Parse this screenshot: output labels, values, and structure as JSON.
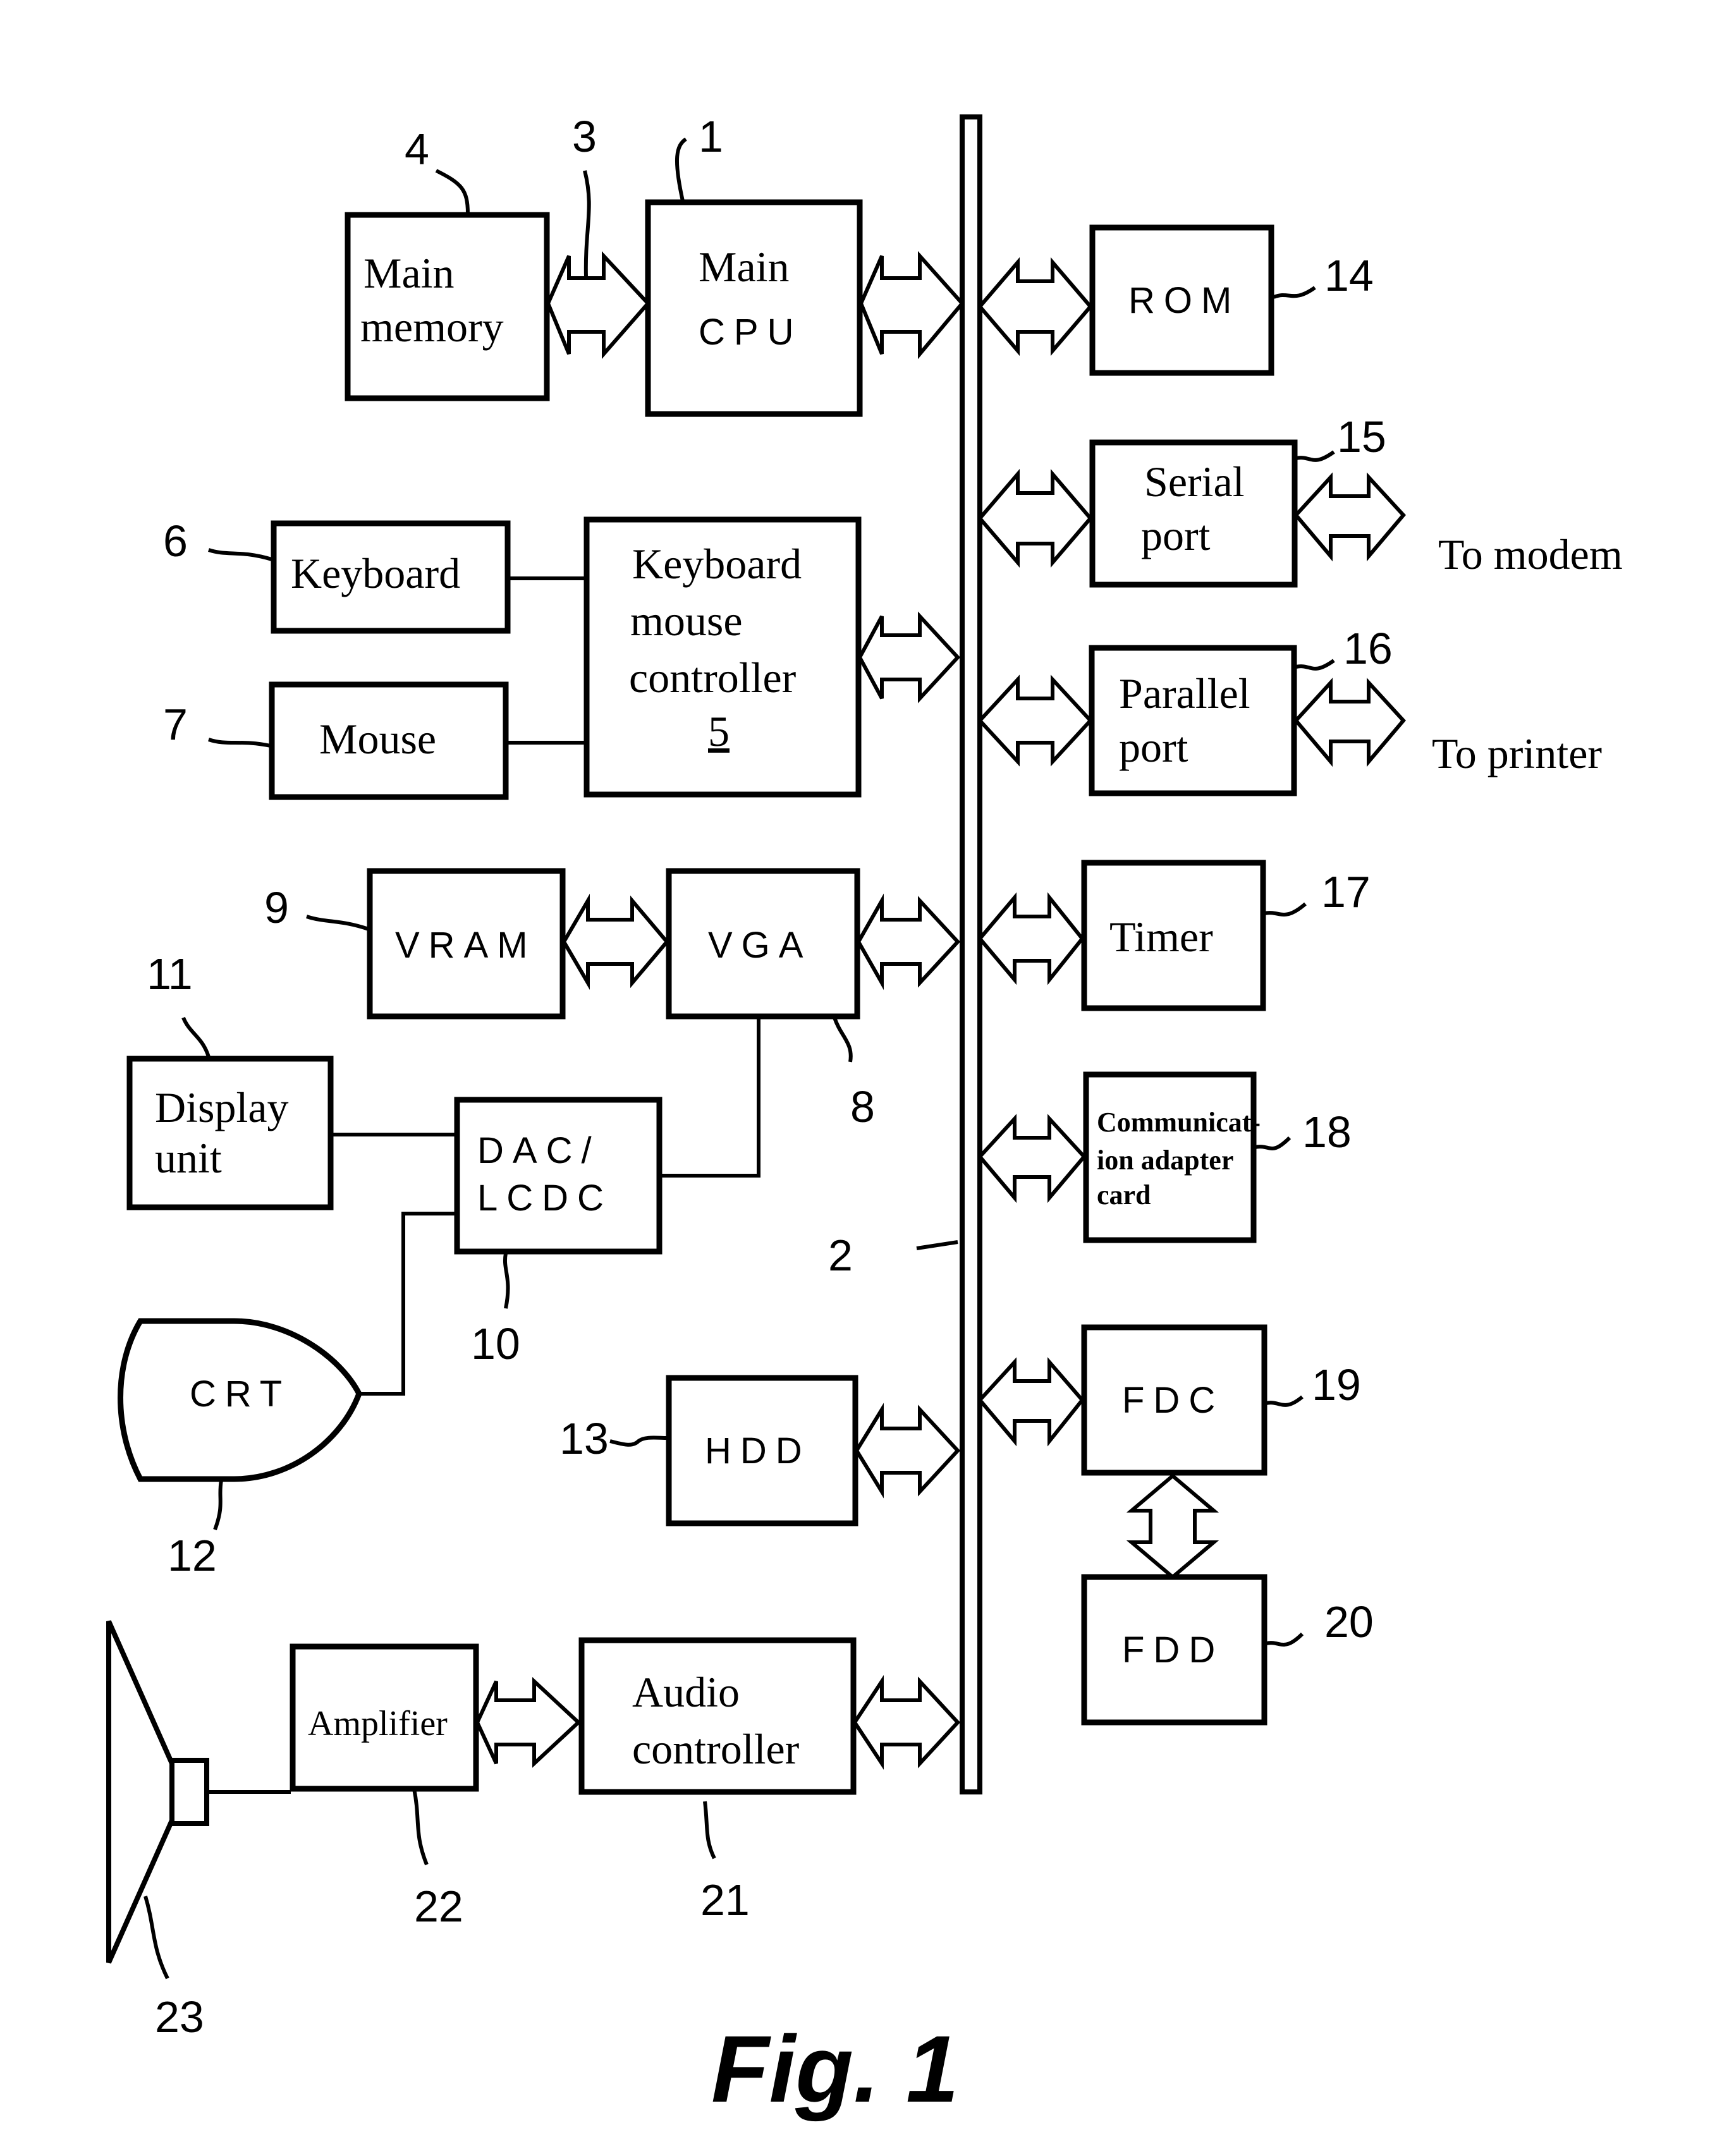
{
  "figure": {
    "caption": "Fig. 1"
  },
  "bus": {
    "ref": "2"
  },
  "blocks": {
    "main_cpu": {
      "ref": "1",
      "line1": "Main",
      "line2": "CPU"
    },
    "local_bus": {
      "ref": "3"
    },
    "main_memory": {
      "ref": "4",
      "line1": "Main",
      "line2": "memory"
    },
    "kbd_mouse_ctrl": {
      "ref": "5",
      "line1": "Keyboard",
      "line2": "mouse",
      "line3": "controller",
      "line4": "5"
    },
    "keyboard": {
      "ref": "6",
      "label": "Keyboard"
    },
    "mouse": {
      "ref": "7",
      "label": "Mouse"
    },
    "vga": {
      "ref": "8",
      "label": "VGA"
    },
    "vram": {
      "ref": "9",
      "label": "VRAM"
    },
    "dac_lcdc": {
      "ref": "10",
      "line1": "DAC/",
      "line2": "LCDC"
    },
    "display_unit": {
      "ref": "11",
      "line1": "Display",
      "line2": "unit"
    },
    "crt": {
      "ref": "12",
      "label": "CRT"
    },
    "hdd": {
      "ref": "13",
      "label": "HDD"
    },
    "rom": {
      "ref": "14",
      "label": "ROM"
    },
    "serial_port": {
      "ref": "15",
      "line1": "Serial",
      "line2": "port",
      "dest": "To modem"
    },
    "parallel_port": {
      "ref": "16",
      "line1": "Parallel",
      "line2": "port",
      "dest": "To printer"
    },
    "timer": {
      "ref": "17",
      "label": "Timer"
    },
    "comm_adapter": {
      "ref": "18",
      "line1": "Communicat-",
      "line2": "ion adapter",
      "line3": "card"
    },
    "fdc": {
      "ref": "19",
      "label": "FDC"
    },
    "fdd": {
      "ref": "20",
      "label": "FDD"
    },
    "audio_ctrl": {
      "ref": "21",
      "line1": "Audio",
      "line2": "controller"
    },
    "amplifier": {
      "ref": "22",
      "label": "Amplifier"
    },
    "speaker": {
      "ref": "23"
    }
  }
}
